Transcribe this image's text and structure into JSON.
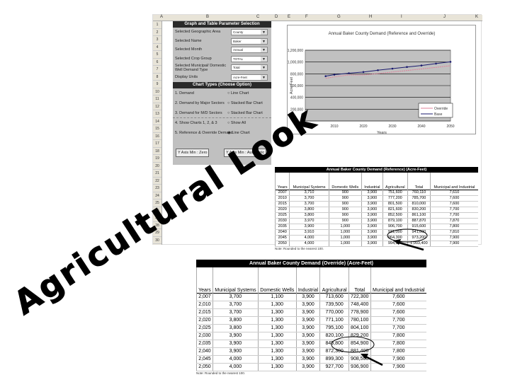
{
  "slide_title": "Agricultural Look",
  "sheet": {
    "columns": [
      "A",
      "B",
      "C",
      "D",
      "E",
      "F",
      "G",
      "H",
      "I",
      "J",
      "K"
    ],
    "rows": [
      "1",
      "2",
      "3",
      "4",
      "5",
      "6",
      "7",
      "8",
      "9",
      "10",
      "11",
      "12",
      "13",
      "14",
      "15",
      "16",
      "17",
      "18",
      "19",
      "20",
      "21",
      "22",
      "23",
      "24",
      "25",
      "26",
      "27",
      "28",
      "29",
      "30"
    ],
    "panel": {
      "header1": "Graph and Table Parameter Selection",
      "params": [
        {
          "label": "Selected Geographic Area",
          "value": "County"
        },
        {
          "label": "Selected Name",
          "value": "Baker"
        },
        {
          "label": "Selected Month",
          "value": "Annual"
        },
        {
          "label": "Selected Crop Group",
          "value": "TOTAL"
        },
        {
          "label": "Selected Municipal/ Domestic Well Demand Type",
          "value": "Total"
        },
        {
          "label": "Display Units",
          "value": "Acre-Feet"
        }
      ],
      "header2": "Chart Types (Choose Option)",
      "chart_types": [
        {
          "label": "1. Demand",
          "option": "Line Chart",
          "selected": false
        },
        {
          "label": "2. Demand by Major Sectors",
          "option": "Stacked Bar Chart",
          "selected": false
        },
        {
          "label": "3. Demand for M/D Sectors",
          "option": "Stacked Bar Chart",
          "selected": false
        },
        {
          "label": "4. Show Charts 1, 2, & 3",
          "option": "Show All",
          "selected": false
        },
        {
          "label": "5. Reference & Override Demand",
          "option": "Line Chart",
          "selected": true
        }
      ],
      "btn_zero": "Y Axis Min : Zero",
      "btn_auto": "Y Axis Min : Automatic"
    }
  },
  "chart_data": {
    "type": "line",
    "title": "Annual Baker County Demand (Reference and Override)",
    "xlabel": "Years",
    "ylabel": "Acre-Feet",
    "xlim": [
      2000,
      2050
    ],
    "ylim": [
      0,
      1200000
    ],
    "xticks": [
      "2,000",
      "2010",
      "2020",
      "2030",
      "2040",
      "2050"
    ],
    "yticks": [
      "0",
      "200,000",
      "400,000",
      "600,000",
      "800,000",
      "1,000,000",
      "1,200,000"
    ],
    "grid": true,
    "legend": "bottom-right",
    "x": [
      2007,
      2010,
      2015,
      2020,
      2025,
      2030,
      2035,
      2040,
      2045,
      2050
    ],
    "series": [
      {
        "name": "Override",
        "color": "#e0809a",
        "values": [
          722500,
          748400,
          779900,
          780100,
          805100,
          830100,
          855800,
          882300,
          909300,
          937700
        ]
      },
      {
        "name": "Base",
        "color": "#1a1a6e",
        "values": [
          760110,
          785700,
          810000,
          830200,
          861100,
          887870,
          915600,
          941000,
          973200,
          1003400
        ]
      }
    ]
  },
  "ref_table": {
    "title": "Annual Baker County Demand (Reference) (Acre-Feet)",
    "headers": [
      "Years",
      "Municipal Systems",
      "Domestic Wells",
      "Industrial",
      "Agricultural",
      "Total",
      "Municipal and Industrial"
    ],
    "rows": [
      [
        "2007",
        "3,710",
        "900",
        "3,900",
        "751,600",
        "760,110",
        "7,610"
      ],
      [
        "2010",
        "3,700",
        "900",
        "3,900",
        "777,200",
        "785,700",
        "7,600"
      ],
      [
        "2015",
        "3,700",
        "900",
        "3,900",
        "801,500",
        "810,000",
        "7,600"
      ],
      [
        "2020",
        "3,800",
        "900",
        "3,900",
        "821,600",
        "830,200",
        "7,700"
      ],
      [
        "2025",
        "3,800",
        "900",
        "3,900",
        "852,500",
        "861,100",
        "7,700"
      ],
      [
        "2030",
        "3,970",
        "900",
        "3,900",
        "879,100",
        "887,870",
        "7,870"
      ],
      [
        "2035",
        "3,900",
        "1,000",
        "3,900",
        "906,700",
        "915,600",
        "7,800"
      ],
      [
        "2040",
        "3,910",
        "1,000",
        "3,900",
        "931,000",
        "941,000",
        "7,810"
      ],
      [
        "2045",
        "4,000",
        "1,000",
        "3,900",
        "964,300",
        "973,200",
        "7,900"
      ],
      [
        "2050",
        "4,000",
        "1,000",
        "3,900",
        "994,500",
        "1,003,400",
        "7,900"
      ]
    ],
    "note": "Note: Rounded to the nearest 100."
  },
  "ovr_table": {
    "title": "Annual Baker County Demand (Override) (Acre-Feet)",
    "headers": [
      "Years",
      "Municipal Systems",
      "Domestic Wells",
      "Industrial",
      "Agricultural",
      "Total",
      "Municipal and Industrial"
    ],
    "rows": [
      [
        "2,007",
        "3,700",
        "1,100",
        "3,900",
        "713,600",
        "722,300",
        "7,600"
      ],
      [
        "2,010",
        "3,700",
        "1,300",
        "3,900",
        "739,500",
        "748,400",
        "7,600"
      ],
      [
        "2,015",
        "3,700",
        "1,300",
        "3,900",
        "770,000",
        "778,900",
        "7,600"
      ],
      [
        "2,020",
        "3,800",
        "1,300",
        "3,900",
        "771,100",
        "780,100",
        "7,700"
      ],
      [
        "2,025",
        "3,800",
        "1,300",
        "3,900",
        "795,100",
        "804,100",
        "7,700"
      ],
      [
        "2,030",
        "3,900",
        "1,300",
        "3,900",
        "820,100",
        "829,200",
        "7,800"
      ],
      [
        "2,035",
        "3,900",
        "1,300",
        "3,900",
        "845,800",
        "854,900",
        "7,800"
      ],
      [
        "2,040",
        "3,900",
        "1,300",
        "3,900",
        "872,300",
        "881,400",
        "7,800"
      ],
      [
        "2,045",
        "4,000",
        "1,300",
        "3,900",
        "899,300",
        "908,500",
        "7,900"
      ],
      [
        "2,050",
        "4,000",
        "1,300",
        "3,900",
        "927,700",
        "936,900",
        "7,900"
      ]
    ],
    "note": "Note: Rounded to the nearest 100."
  }
}
